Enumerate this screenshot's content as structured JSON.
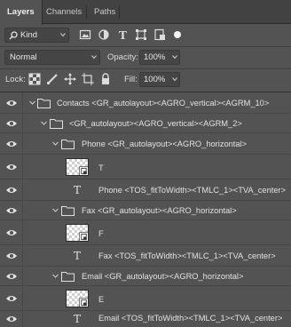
{
  "tabs": [
    {
      "label": "Layers",
      "active": true
    },
    {
      "label": "Channels",
      "active": false
    },
    {
      "label": "Paths",
      "active": false
    }
  ],
  "filter": {
    "kind_label": "Kind",
    "icons": [
      "image-filter-icon",
      "adjustment-filter-icon",
      "type-filter-icon",
      "shape-filter-icon",
      "smart-object-filter-icon",
      "filter-toggle-icon"
    ]
  },
  "blend": {
    "mode": "Normal",
    "opacity_label": "Opacity:",
    "opacity_value": "100%"
  },
  "lock": {
    "label": "Lock:",
    "icons": [
      "lock-transparency-icon",
      "lock-image-icon",
      "lock-position-icon",
      "lock-artboard-icon",
      "lock-all-icon"
    ],
    "fill_label": "Fill:",
    "fill_value": "100%"
  },
  "layers": [
    {
      "type": "group",
      "indent": 0,
      "name": "Contacts <GR_autolayout><AGRO_vertical><AGRM_10>"
    },
    {
      "type": "group",
      "indent": 1,
      "name": "<GR_autolayout><AGRO_vertical><AGRM_2>"
    },
    {
      "type": "group",
      "indent": 2,
      "name": "Phone <GR_autolayout><AGRO_horizontal>"
    },
    {
      "type": "smart",
      "indent": 3,
      "name": "T"
    },
    {
      "type": "text",
      "indent": 3,
      "name": "Phone <TOS_fitToWidth><TMLC_1><TVA_center>"
    },
    {
      "type": "group",
      "indent": 2,
      "name": "Fax <GR_autolayout><AGRO_horizontal>"
    },
    {
      "type": "smart",
      "indent": 3,
      "name": "F"
    },
    {
      "type": "text",
      "indent": 3,
      "name": "Fax <TOS_fitToWidth><TMLC_1><TVA_center>"
    },
    {
      "type": "group",
      "indent": 2,
      "name": "Email <GR_autolayout><AGRO_horizontal>"
    },
    {
      "type": "smart",
      "indent": 3,
      "name": "E"
    },
    {
      "type": "text",
      "indent": 3,
      "name": "Email <TOS_fitToWidth><TMLC_1><TVA_center>"
    }
  ]
}
